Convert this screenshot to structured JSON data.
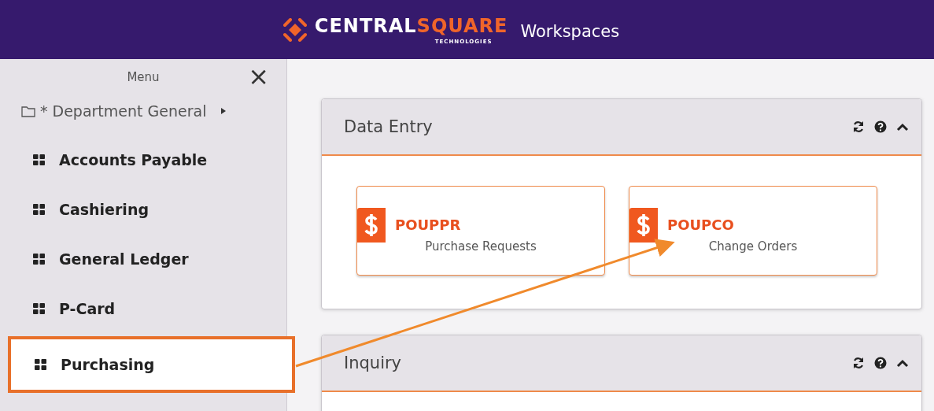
{
  "header": {
    "logo": {
      "name_part1": "CENTRAL",
      "name_part2": "SQUARE",
      "tagline": "TECHNOLOGIES"
    },
    "title": "Workspaces"
  },
  "sidebar": {
    "title": "Menu",
    "close": "×",
    "folder": {
      "label": "* Department General",
      "expanded": false
    },
    "items": [
      {
        "label": "Accounts Payable",
        "highlighted": false
      },
      {
        "label": "Cashiering",
        "highlighted": false
      },
      {
        "label": "General Ledger",
        "highlighted": false
      },
      {
        "label": "P-Card",
        "highlighted": false
      },
      {
        "label": "Purchasing",
        "highlighted": true
      }
    ]
  },
  "panels": [
    {
      "title": "Data Entry",
      "tiles": [
        {
          "code": "POUPPR",
          "description": "Purchase Requests"
        },
        {
          "code": "POUPCO",
          "description": "Change Orders"
        }
      ]
    },
    {
      "title": "Inquiry"
    }
  ]
}
